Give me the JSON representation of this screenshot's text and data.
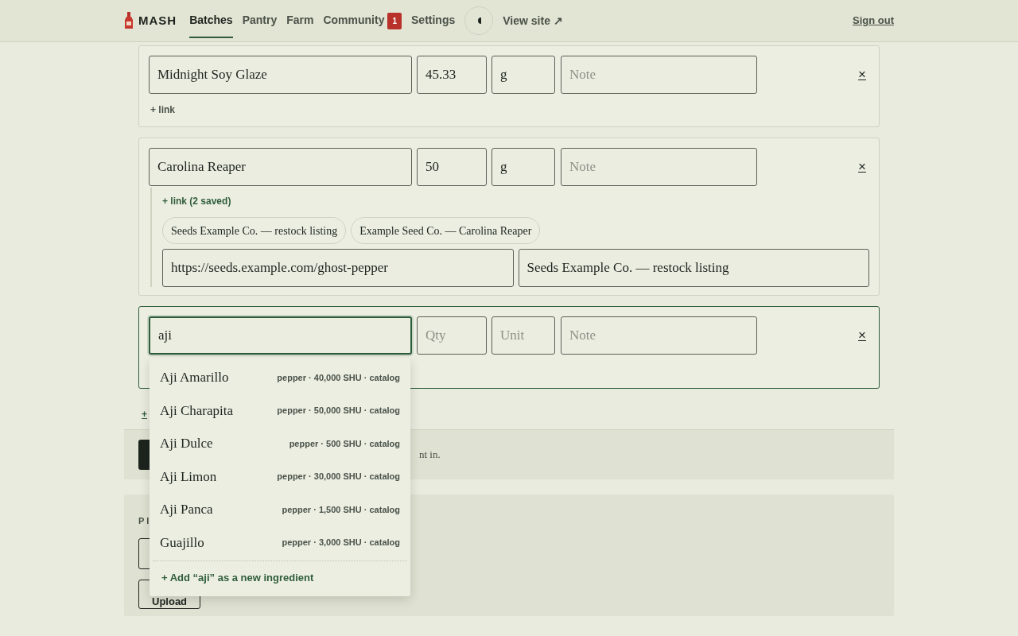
{
  "nav": {
    "brand": "MASH",
    "items": [
      {
        "label": "Batches",
        "selected": true
      },
      {
        "label": "Pantry",
        "selected": false
      },
      {
        "label": "Farm",
        "selected": false
      },
      {
        "label": "Community",
        "selected": false,
        "badge": "1"
      },
      {
        "label": "Settings",
        "selected": false
      }
    ],
    "view_site": "View site ↗",
    "sign_out": "Sign out"
  },
  "ingredients": [
    {
      "name": {
        "value": "Midnight Soy Glaze"
      },
      "qty": {
        "value": "45.33"
      },
      "unit": {
        "value": "g"
      },
      "note": {
        "placeholder": "Note"
      },
      "remove": "×",
      "focused": false,
      "link_toggle": "+ link"
    },
    {
      "name": {
        "value": "Carolina Reaper"
      },
      "qty": {
        "value": "50"
      },
      "unit": {
        "value": "g"
      },
      "note": {
        "placeholder": "Note"
      },
      "remove": "×",
      "focused": false,
      "links": {
        "toggle": "+ link (2 saved)",
        "saved": [
          "Seeds Example Co. — restock listing",
          "Example Seed Co. — Carolina Reaper"
        ],
        "url": {
          "value": "https://seeds.example.com/ghost-pepper"
        },
        "label": {
          "value": "Seeds Example Co. — restock listing"
        }
      }
    },
    {
      "name": {
        "value": "aji"
      },
      "qty": {
        "placeholder": "Qty"
      },
      "unit": {
        "placeholder": "Unit"
      },
      "note": {
        "placeholder": "Note"
      },
      "remove": "×",
      "focused": true,
      "suggestions": [
        {
          "name": "Aji Amarillo",
          "meta": "pepper · 40,000 SHU · catalog"
        },
        {
          "name": "Aji Charapita",
          "meta": "pepper · 50,000 SHU · catalog"
        },
        {
          "name": "Aji Dulce",
          "meta": "pepper · 500 SHU · catalog"
        },
        {
          "name": "Aji Limon",
          "meta": "pepper · 30,000 SHU · catalog"
        },
        {
          "name": "Aji Panca",
          "meta": "pepper · 1,500 SHU · catalog"
        },
        {
          "name": "Guajillo",
          "meta": "pepper · 3,000 SHU · catalog"
        }
      ],
      "add_new": "+ Add “aji” as a new ingredient"
    }
  ],
  "add_ingredient": "+",
  "save_hint": "nt in.",
  "photos": {
    "heading": "PI",
    "upload": "Upload"
  }
}
